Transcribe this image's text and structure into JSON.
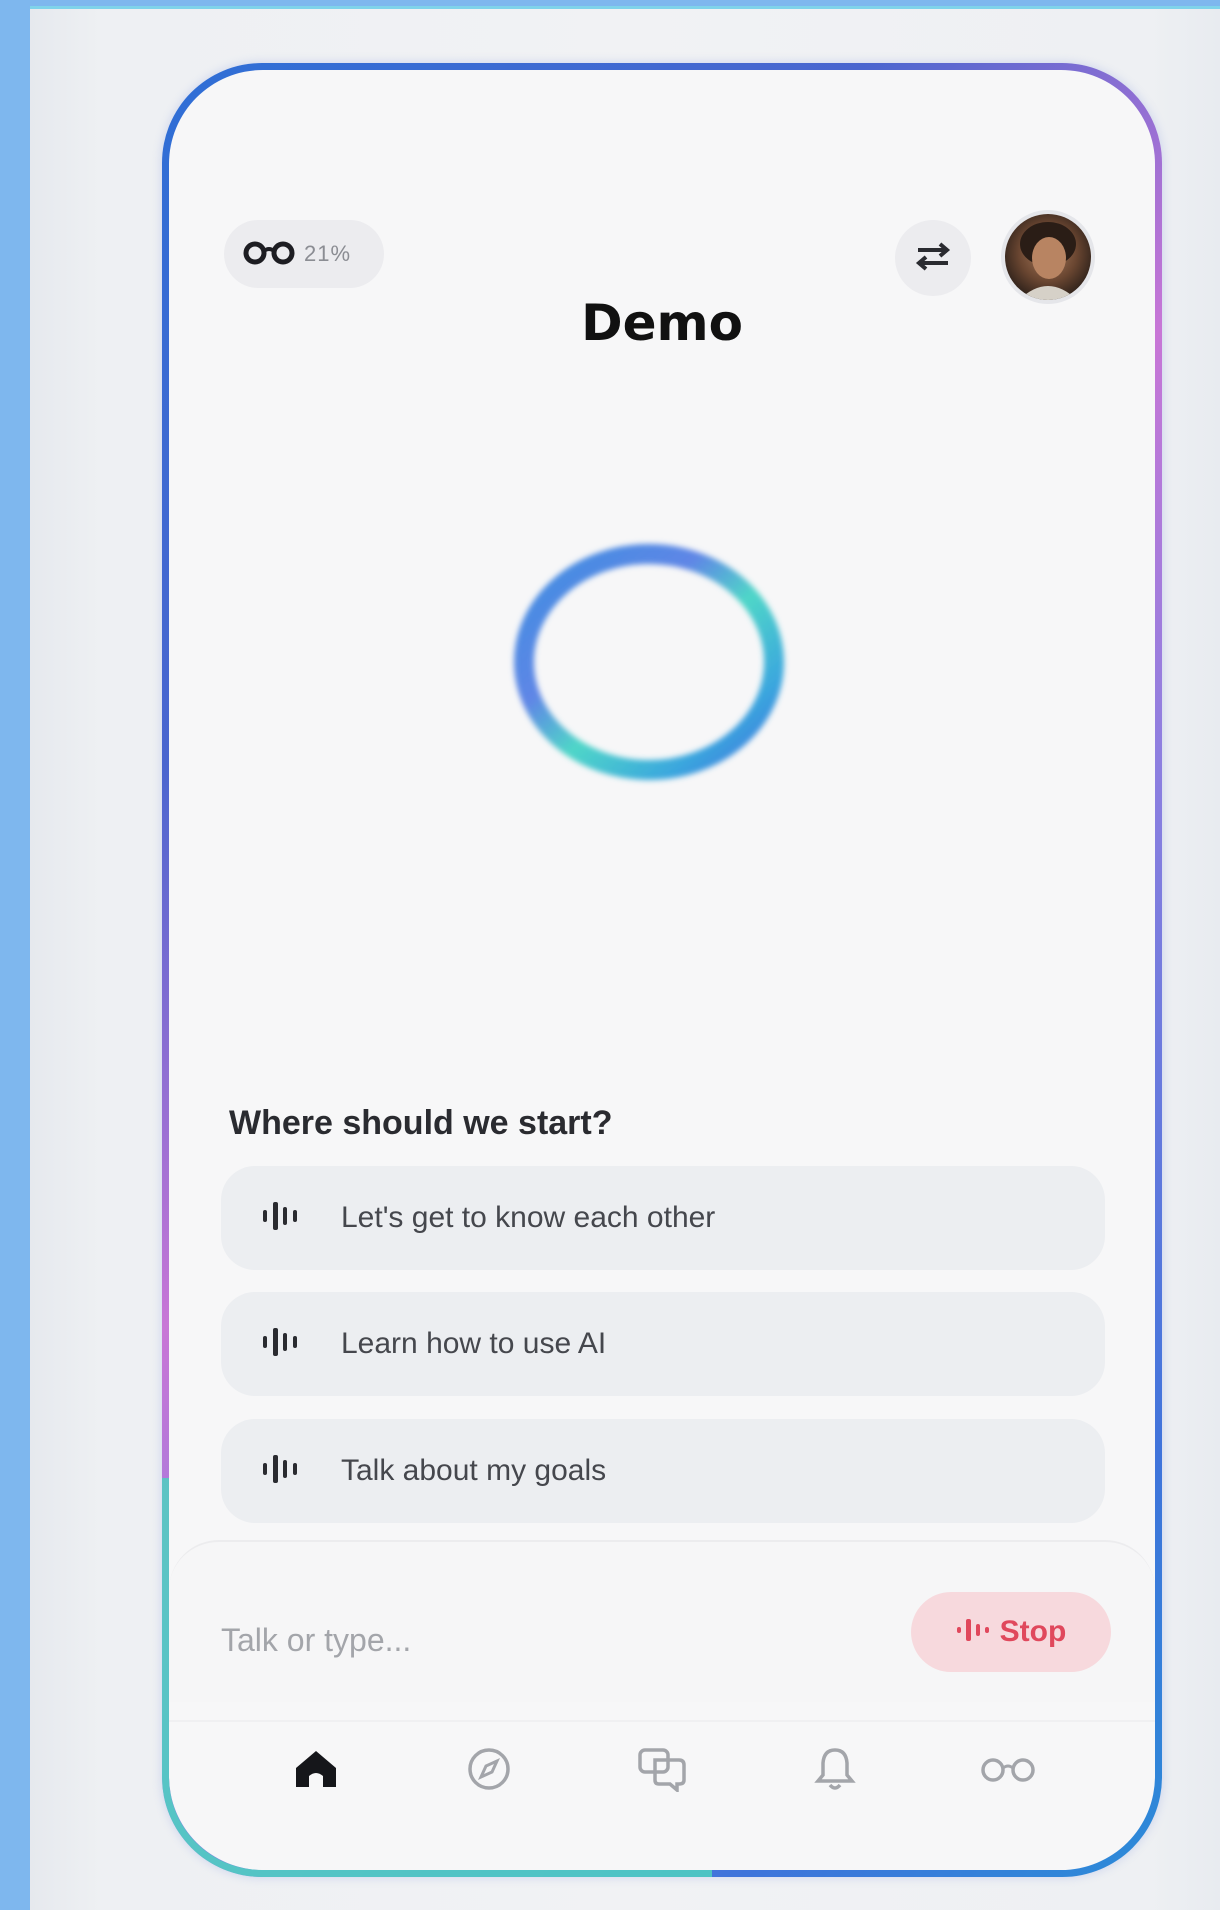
{
  "header": {
    "battery_percent": "21%",
    "title": "Demo"
  },
  "icons": {
    "battery": "glasses-icon",
    "settings": "sliders-icon",
    "profile": "avatar",
    "orb": "listening-orb",
    "suggestion": "voice-wave-icon",
    "stop": "voice-wave-icon"
  },
  "prompts": {
    "heading": "Where should we start?",
    "items": [
      {
        "label": "Let's get to know each other"
      },
      {
        "label": "Learn how to use AI"
      },
      {
        "label": "Talk about my goals"
      }
    ]
  },
  "composer": {
    "placeholder": "Talk or type...",
    "stop_label": "Stop"
  },
  "tabs": [
    {
      "name": "home",
      "icon": "home-icon",
      "active": true
    },
    {
      "name": "explore",
      "icon": "compass-icon",
      "active": false
    },
    {
      "name": "chats",
      "icon": "chat-icon",
      "active": false
    },
    {
      "name": "notifications",
      "icon": "bell-icon",
      "active": false
    },
    {
      "name": "glasses",
      "icon": "glasses-icon",
      "active": false
    }
  ],
  "colors": {
    "accent_stop": "#e0485c",
    "stop_bg": "#f7d9dd",
    "frame_blue": "#2e6fd6",
    "frame_pink": "#c876d6",
    "frame_teal": "#4fd1c1"
  }
}
